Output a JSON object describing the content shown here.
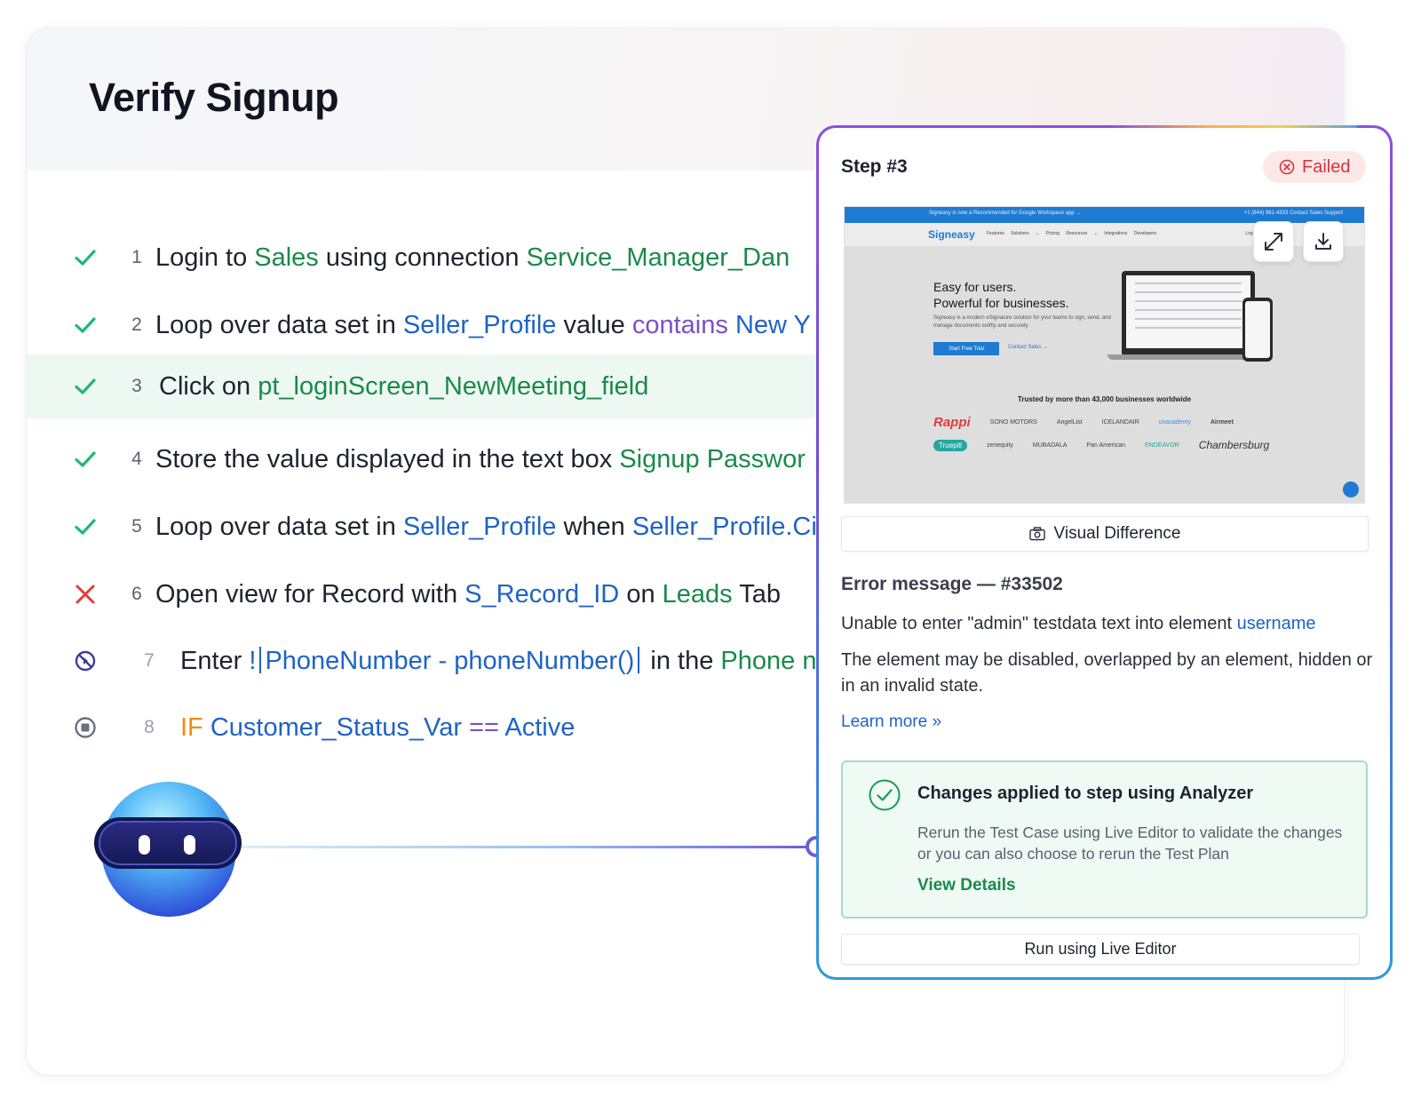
{
  "page": {
    "title": "Verify Signup"
  },
  "steps": [
    {
      "number": "1",
      "status": "passed",
      "parts": [
        {
          "t": "Login to"
        },
        {
          "t": "Sales",
          "c": "g"
        },
        {
          "t": "using connection"
        },
        {
          "t": "Service_Manager_Dan",
          "c": "g"
        }
      ]
    },
    {
      "number": "2",
      "status": "passed",
      "parts": [
        {
          "t": "Loop over data set in"
        },
        {
          "t": "Seller_Profile",
          "c": "b"
        },
        {
          "t": "value"
        },
        {
          "t": "contains",
          "c": "p"
        },
        {
          "t": "New Y",
          "c": "b"
        }
      ]
    },
    {
      "number": "3",
      "status": "passed",
      "parts": [
        {
          "t": "Click on"
        },
        {
          "t": "pt_loginScreen_NewMeeting_field",
          "c": "g"
        }
      ]
    },
    {
      "number": "4",
      "status": "passed",
      "parts": [
        {
          "t": "Store the value displayed in the text box"
        },
        {
          "t": "Signup Passwor",
          "c": "g"
        }
      ]
    },
    {
      "number": "5",
      "status": "passed",
      "parts": [
        {
          "t": "Loop over data set in"
        },
        {
          "t": "Seller_Profile",
          "c": "b"
        },
        {
          "t": "when"
        },
        {
          "t": "Seller_Profile.Ci",
          "c": "b"
        }
      ]
    },
    {
      "number": "6",
      "status": "failed",
      "parts": [
        {
          "t": "Open view for Record with"
        },
        {
          "t": "S_Record_ID",
          "c": "b"
        },
        {
          "t": "on"
        },
        {
          "t": "Leads",
          "c": "g"
        },
        {
          "t": "Tab"
        }
      ]
    },
    {
      "number": "7",
      "status": "disabled",
      "parts": [
        {
          "t": "Enter"
        },
        {
          "t": "!",
          "c": "b"
        },
        {
          "t": "PhoneNumber - phoneNumber()",
          "c": "b"
        },
        {
          "t": "in the"
        },
        {
          "t": "Phone n",
          "c": "g"
        }
      ]
    },
    {
      "number": "8",
      "status": "stopped",
      "parts": [
        {
          "t": "IF",
          "c": "o"
        },
        {
          "t": "Customer_Status_Var",
          "c": "b"
        },
        {
          "t": "==",
          "c": "p"
        },
        {
          "t": "Active",
          "c": "b"
        }
      ]
    }
  ],
  "detail": {
    "step_label": "Step #3",
    "status_badge": "Failed",
    "visual_difference_label": "Visual Difference",
    "error_title": "Error message — #33502",
    "error_prefix": "Unable to enter \"admin\" testdata text  into element",
    "error_element": "username",
    "error_description": "The element may be disabled, overlapped by an element, hidden or in an invalid state.",
    "learn_more": "Learn more »",
    "analyzer": {
      "title": "Changes applied to step using Analyzer",
      "description": "Rerun the Test Case using Live Editor to validate the changes or you can also choose to rerun the Test Plan",
      "view_details": "View Details"
    },
    "run_button": "Run using Live Editor"
  },
  "screenshot": {
    "topbar_text": "Signeasy is now a Recommended for Google Workspace app →",
    "topbar_right": "+1 (844) 961-4333   Contact Sales   Support",
    "logo": "Signeasy",
    "menu": "Features  Solutions ⌄  Pricing  Resources ⌄  Integrations  Developers",
    "login": "Log in",
    "headline_1": "Easy for users.",
    "headline_2": "Powerful for businesses.",
    "body": "Signeasy is a modern eSignature solution for your teams to sign, send, and manage documents swiftly and securely.",
    "cta_primary": "Start Free Trial",
    "cta_secondary": "Contact Sales →",
    "trusted": "Trusted by more than 43,000 businesses worldwide",
    "logos": [
      "Rappi",
      "SONO MOTORS",
      "AngelList",
      "ICELANDAIR",
      "unacademy",
      "Airmeet",
      "Truepill",
      "zenequity",
      "MUBADALA",
      "Pan American",
      "ENDEAVOR",
      "Chambersburg"
    ]
  },
  "colors": {
    "accent_green": "#1a8a4a",
    "accent_blue": "#1f63c6",
    "accent_purple": "#7b4fc9",
    "failed_red": "#d8323a",
    "check_green": "#1fb870"
  }
}
